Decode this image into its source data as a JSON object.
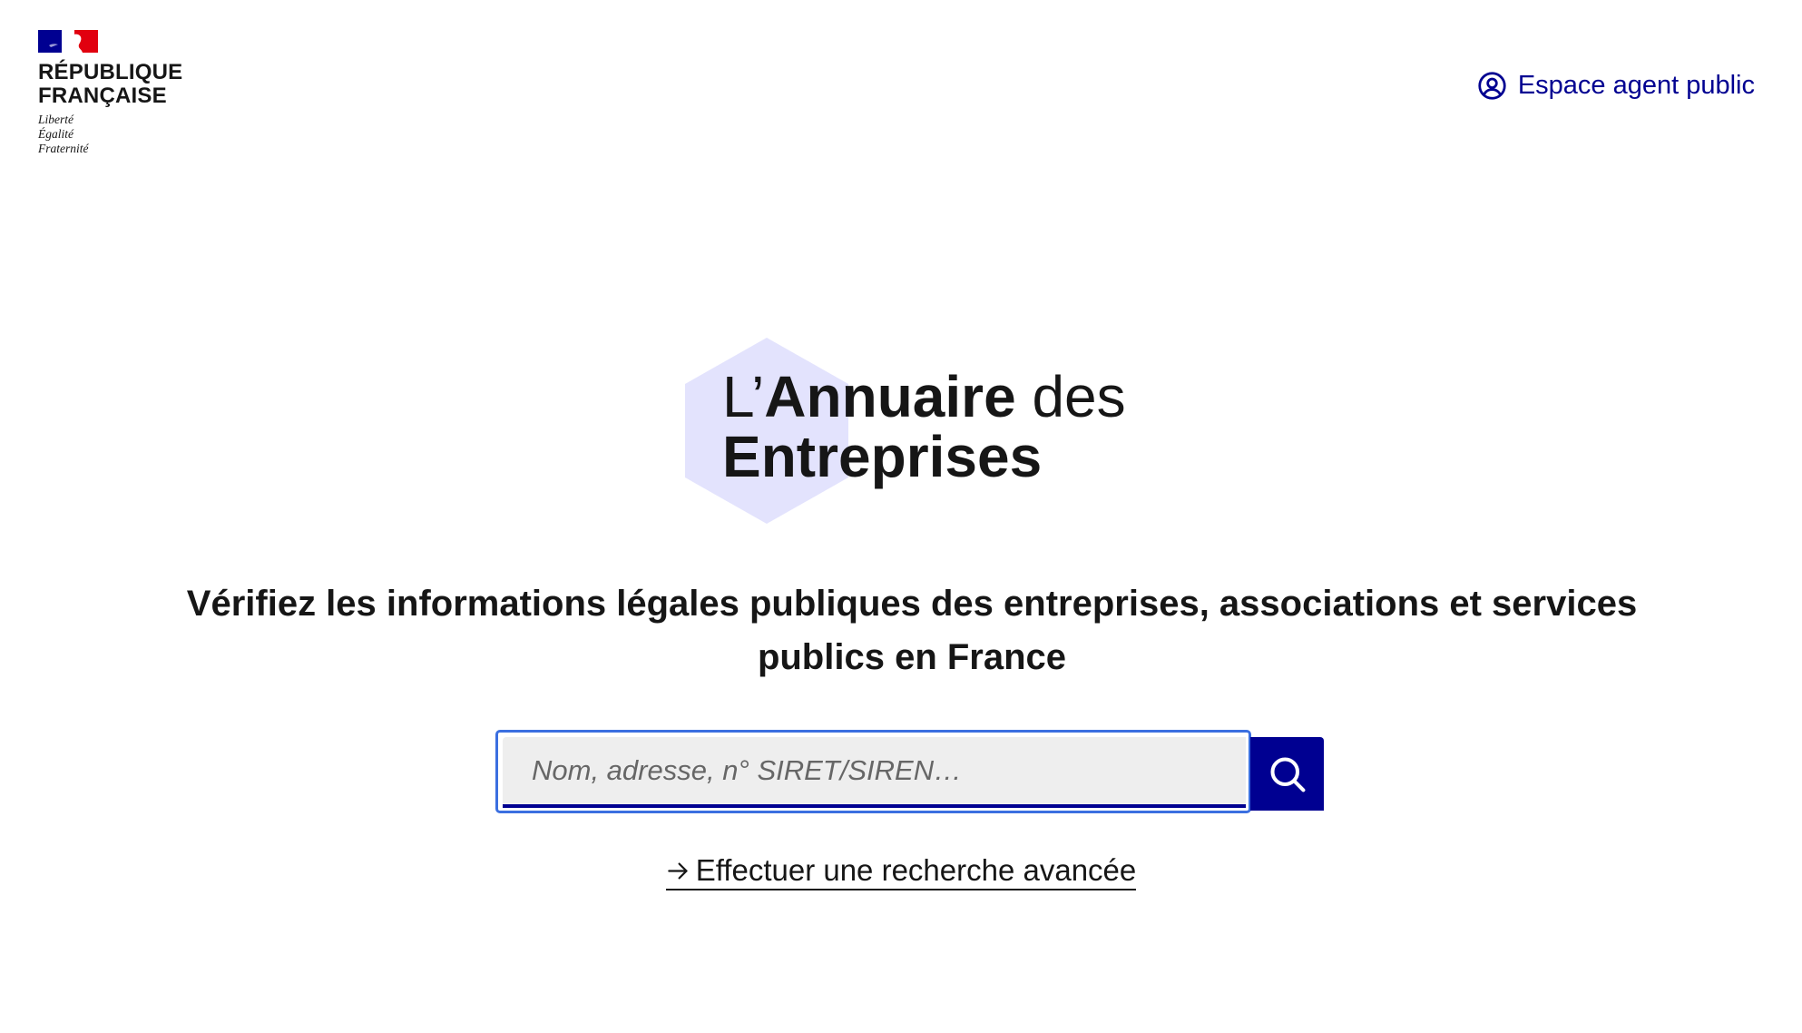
{
  "header": {
    "gov_logo": {
      "name_line1": "RÉPUBLIQUE",
      "name_line2": "FRANÇAISE",
      "motto": [
        "Liberté",
        "Égalité",
        "Fraternité"
      ]
    },
    "agent_link": {
      "icon": "user-circle-icon",
      "label": "Espace agent public"
    }
  },
  "brand": {
    "prefix": "L’",
    "bold1": "Annuaire",
    "suffix": " des",
    "bold2": "Entreprises"
  },
  "hero": {
    "tagline": "Vérifiez les informations légales publiques des entreprises, associations et services publics en France"
  },
  "search": {
    "placeholder": "Nom, adresse, n° SIRET/SIREN…",
    "value": "",
    "button_icon": "search-icon"
  },
  "advanced_search": {
    "icon": "arrow-right-icon",
    "label": "Effectuer une recherche avancée"
  },
  "colors": {
    "primary": "#000091",
    "focus": "#3b6fe0",
    "input_bg": "#eeeeee",
    "hex_bg": "#e3e3fd",
    "flag_blue": "#000091",
    "flag_red": "#e1000f",
    "text": "#161616"
  }
}
